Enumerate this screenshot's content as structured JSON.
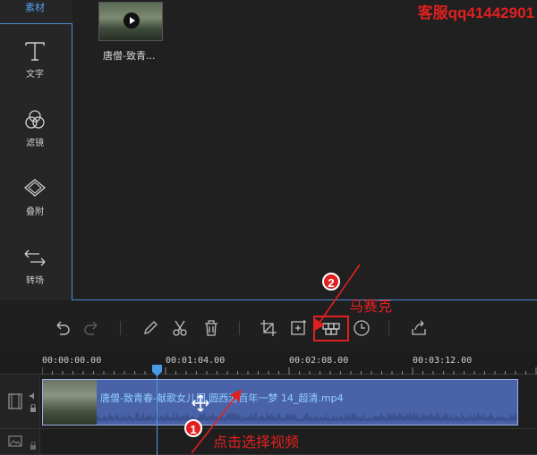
{
  "sidebar": {
    "top_label": "素材",
    "items": [
      {
        "label": "文字",
        "icon": "text-icon"
      },
      {
        "label": "滤镜",
        "icon": "filter-icon"
      },
      {
        "label": "叠附",
        "icon": "overlay-icon"
      },
      {
        "label": "转场",
        "icon": "transition-icon"
      }
    ]
  },
  "media": {
    "thumbnail_name": "唐僧-致青...",
    "service_text": "客服qq41442901"
  },
  "toolbar": {
    "icons": [
      "undo-icon",
      "redo-icon",
      "edit-icon",
      "cut-icon",
      "delete-icon",
      "crop-icon",
      "zoom-icon",
      "mosaic-icon",
      "speed-icon",
      "export-icon"
    ]
  },
  "ruler": {
    "timecodes": [
      "00:00:00.00",
      "00:01:04.00",
      "00:02:08.00",
      "00:03:12.00"
    ]
  },
  "timeline": {
    "clip_title": "唐僧-致青春-献歌女儿国 圆西游百年一梦 14_超清.mp4"
  },
  "annotations": {
    "step1_num": "1",
    "step1_text": "点击选择视频",
    "step2_num": "2",
    "step2_text": "马赛克"
  },
  "colors": {
    "accent": "#4a8ad8",
    "annotation": "#e02020",
    "clip": "#4a63a8"
  }
}
